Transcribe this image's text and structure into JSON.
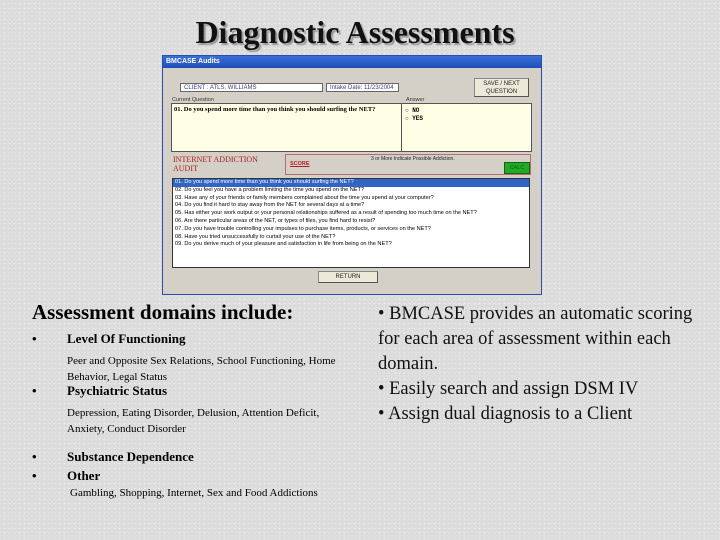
{
  "slide": {
    "title": "Diagnostic Assessments"
  },
  "app": {
    "window_title": "BMCASE Audits",
    "client_field": "CLIENT : ATLS, WILLIAMS",
    "intake_date": "Intake Date: 11/23/2004",
    "save_next_label": "SAVE / NEXT QUESTION",
    "current_question_label": "Current Question",
    "answer_label": "Answer",
    "current_question": "01. Do you spend more time than you think you should surfing the NET?",
    "answers": [
      "NO",
      "YES"
    ],
    "audit_title": "INTERNET ADDICTION AUDIT",
    "score_label": "SCORE",
    "score_note": "3 or More Indicate Possible Addiction.",
    "calc_label": "CALC",
    "questions": [
      "01. Do you spend more time than you think you should surfing the NET?",
      "02. Do you feel you have a problem limiting the time you spend on the NET?",
      "03. Have any of your friends or family members complained about the time you spend at your computer?",
      "04. Do you find it hard to stay away from the NET for several days at a time?",
      "05. Has either your work output or your personal relationships suffered as a result of spending too much time on the NET?",
      "06. Are there particular areas of the NET, or types of files, you find hard to resist?",
      "07. Do you have trouble controlling your impulses to purchase items, products, or services on the NET?",
      "08. Have you tried unsuccessfully to curtail your use of the NET?",
      "09. Do you derive much of your pleasure and satisfaction in life from being on the NET?"
    ],
    "return_label": "RETURN"
  },
  "left": {
    "heading": "Assessment domains include:",
    "bullet": "•",
    "items": [
      {
        "label": "Level Of Functioning",
        "detail": "Peer and Opposite Sex Relations, School Functioning, Home Behavior, Legal Status"
      },
      {
        "label": "Psychiatric Status",
        "detail": "Depression, Eating Disorder, Delusion, Attention Deficit, Anxiety, Conduct Disorder"
      },
      {
        "label": "Substance Dependence",
        "detail": ""
      },
      {
        "label": "Other",
        "detail": "Gambling, Shopping, Internet, Sex and Food Addictions"
      }
    ]
  },
  "right": {
    "points": [
      "• BMCASE provides an automatic scoring for each area of assessment within each domain.",
      "• Easily search and assign DSM IV",
      "• Assign dual diagnosis to a Client"
    ]
  }
}
